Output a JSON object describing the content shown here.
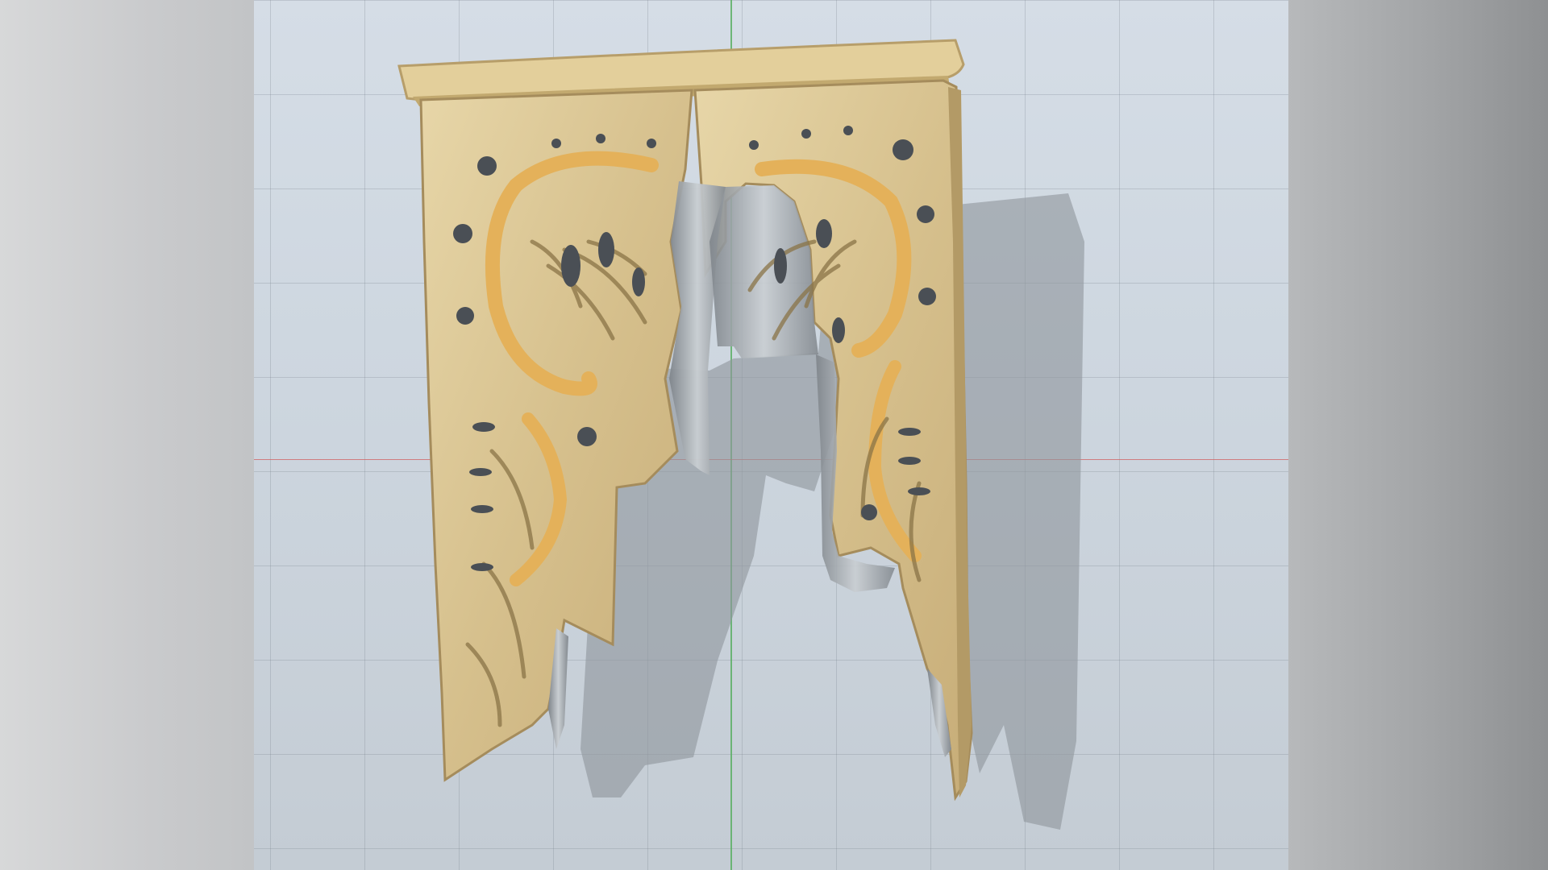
{
  "viewport": {
    "kind": "3d-model-viewer",
    "background_color": "#cdd6df",
    "grid_color": "#7a8792",
    "axis_x_color": "#d25f5f",
    "axis_y_color": "#5aaf64"
  },
  "model": {
    "icon": "carved-bracket-icon",
    "wood_color": "#d8c28e",
    "highlight_color": "#e6b25a",
    "shadow_color": "#8f969c",
    "hole_color": "#4a4f55"
  }
}
